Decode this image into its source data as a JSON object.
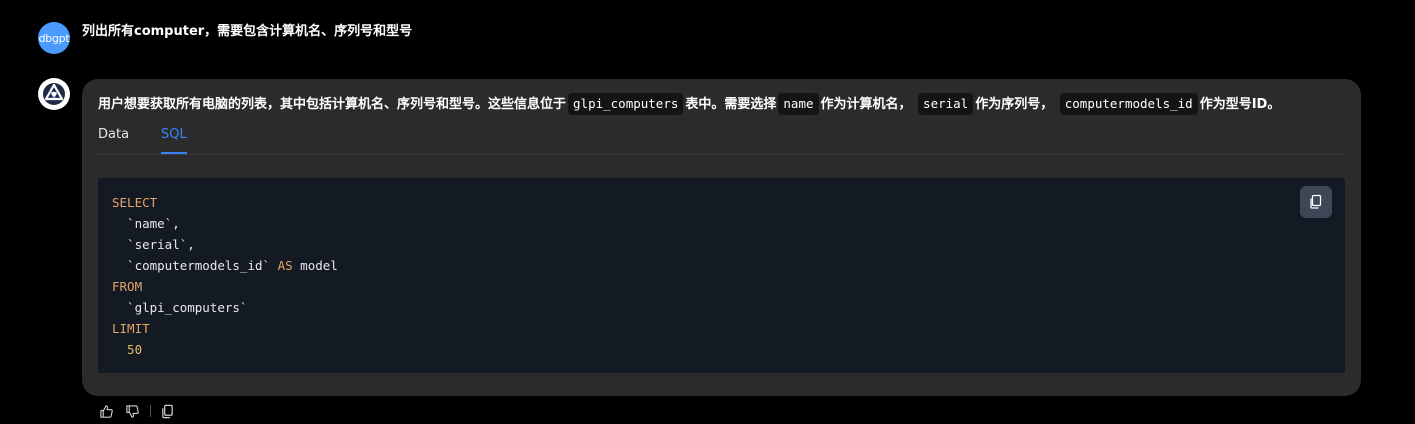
{
  "user": {
    "avatar_label": "dbgpt",
    "message": "列出所有computer，需要包含计算机名、序列号和型号"
  },
  "answer": {
    "text_parts": [
      "用户想要获取所有电脑的列表，其中包括计算机名、序列号和型号。这些信息位于",
      "表中。需要选择",
      "作为计算机名，",
      "作为序列号，",
      "作为型号ID。"
    ],
    "inline_code": [
      "glpi_computers",
      "name",
      "serial",
      "computermodels_id"
    ]
  },
  "tabs": [
    {
      "label": "Data",
      "active": false
    },
    {
      "label": "SQL",
      "active": true
    }
  ],
  "code": {
    "lines": {
      "l1_kw": "SELECT",
      "l2": "  `name`,",
      "l3": "  `serial`,",
      "l4_pre": "  `computermodels_id` ",
      "l4_kw": "AS",
      "l4_post": " model",
      "l5_kw": "FROM",
      "l6": "  `glpi_computers`",
      "l7_kw": "LIMIT",
      "l8_num": "  50"
    }
  },
  "icons": {
    "copy_code": "copy-icon",
    "thumbs_up": "thumbs-up-icon",
    "thumbs_down": "thumbs-down-icon",
    "copy_message": "copy-icon"
  },
  "colors": {
    "user_avatar": "#4a9bff",
    "tab_active": "#3b82f6",
    "keyword": "#e5a467",
    "bubble_bg": "#2b2b2b",
    "code_bg": "#141a24"
  }
}
